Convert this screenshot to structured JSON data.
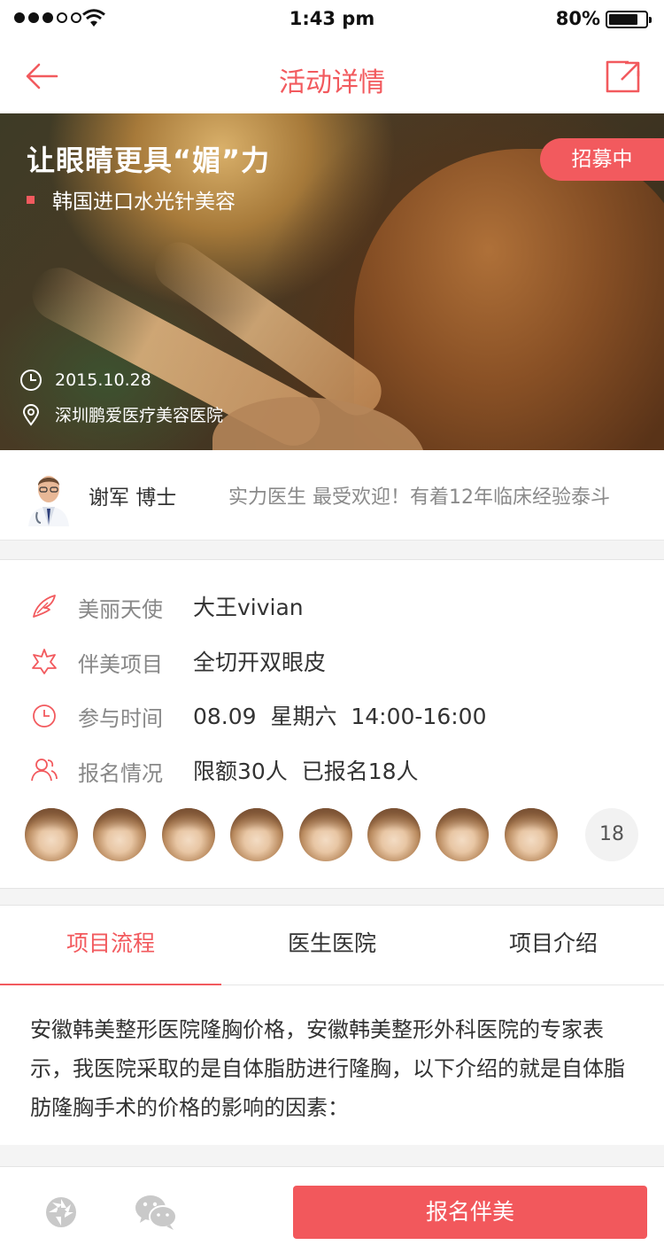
{
  "status_bar": {
    "time": "1:43 pm",
    "battery_percent": "80%",
    "signal_bars_filled": 3,
    "signal_bars_total": 5,
    "battery_level": 0.8
  },
  "nav": {
    "title": "活动详情",
    "back_icon": "arrow-left-icon",
    "share_icon": "share-external-icon"
  },
  "hero": {
    "headline": "让眼睛更具“媚”力",
    "subtitle": "韩国进口水光针美容",
    "badge": "招募中",
    "date": "2015.10.28",
    "location": "深圳鹏爱医疗美容医院"
  },
  "doctor": {
    "name": "谢军 博士",
    "description": "实力医生 最受欢迎！有着12年临床经验泰斗"
  },
  "info": {
    "rows": [
      {
        "icon": "wing-icon",
        "label": "美丽天使",
        "value": "大王vivian"
      },
      {
        "icon": "star-burst-icon",
        "label": "伴美项目",
        "value": "全切开双眼皮"
      },
      {
        "icon": "clock-icon",
        "label": "参与时间",
        "value": "08.09  星期六  14:00-16:00"
      },
      {
        "icon": "users-icon",
        "label": "报名情况",
        "value": "限额30人  已报名18人"
      }
    ],
    "participant_avatars_shown": 8,
    "participant_count": "18"
  },
  "tabs": [
    {
      "label": "项目流程",
      "active": true
    },
    {
      "label": "医生医院",
      "active": false
    },
    {
      "label": "项目介绍",
      "active": false
    }
  ],
  "content": {
    "text": "安徽韩美整形医院隆胸价格，安徽韩美整形外科医院的专家表示，我医院采取的是自体脂肪进行隆胸，以下介绍的就是自体脂肪隆胸手术的价格的影响的因素："
  },
  "bottom_bar": {
    "cta_label": "报名伴美",
    "share_moments_icon": "moments-icon",
    "wechat_icon": "wechat-icon"
  },
  "colors": {
    "accent": "#f25a5e",
    "cta": "#f2585c",
    "muted_text": "#888888",
    "divider_bg": "#f4f4f4"
  }
}
